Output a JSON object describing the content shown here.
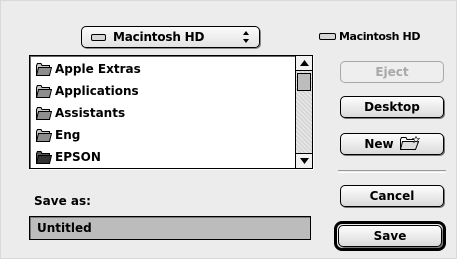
{
  "volume_popup": {
    "label": "Macintosh HD",
    "icon": "hard-drive-icon",
    "arrows": "⬍"
  },
  "current_volume": {
    "label": "Macintosh HD",
    "icon": "hard-drive-icon"
  },
  "file_list": {
    "items": [
      {
        "label": "Apple Extras",
        "icon": "folder-icon"
      },
      {
        "label": "Applications",
        "icon": "folder-icon"
      },
      {
        "label": "Assistants",
        "icon": "folder-icon"
      },
      {
        "label": "Eng",
        "icon": "folder-icon"
      },
      {
        "label": "EPSON",
        "icon": "folder-icon"
      }
    ]
  },
  "buttons": {
    "eject": "Eject",
    "desktop": "Desktop",
    "new": "New",
    "cancel": "Cancel",
    "save": "Save"
  },
  "save_as": {
    "label": "Save as:",
    "value": "Untitled"
  },
  "colors": {
    "dialog_background": "#ececec",
    "selection_field": "#bcbcbc",
    "disabled_text": "#a8a8a8"
  }
}
